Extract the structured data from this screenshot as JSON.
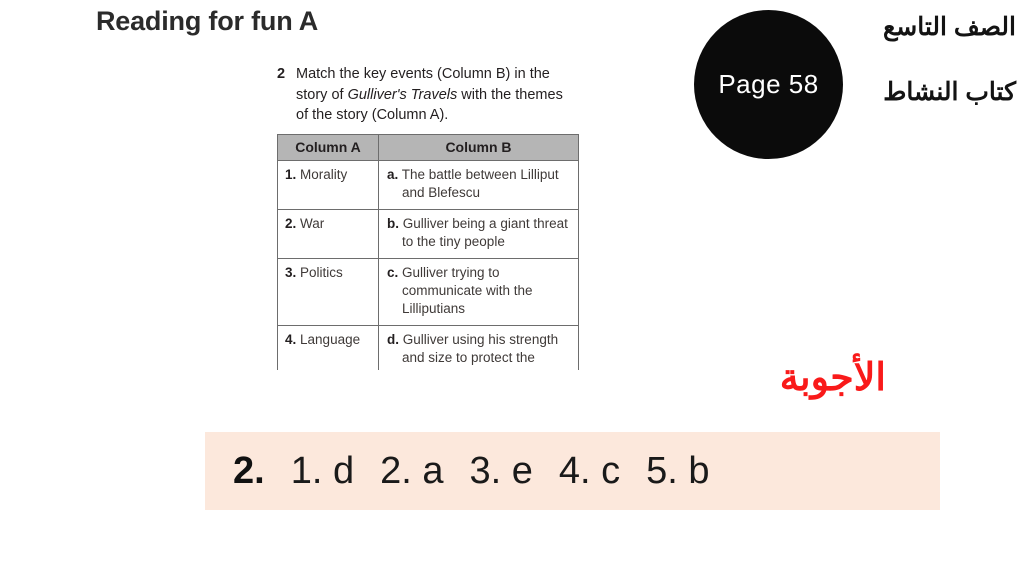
{
  "page_title": "Reading for fun A",
  "worksheet": {
    "instruction_number": "2",
    "instruction_part1": "Match the key events (Column B) in the story of ",
    "instruction_italic": "Gulliver's Travels",
    "instruction_part2": " with the themes of the story (Column A).",
    "table": {
      "headers": [
        "Column A",
        "Column B"
      ],
      "rows": [
        {
          "a_marker": "1.",
          "a_text": "Morality",
          "b_marker": "a.",
          "b_text": "The battle between Lilliput and Blefescu"
        },
        {
          "a_marker": "2.",
          "a_text": "War",
          "b_marker": "b.",
          "b_text": "Gulliver being a giant threat to the tiny people"
        },
        {
          "a_marker": "3.",
          "a_text": "Politics",
          "b_marker": "c.",
          "b_text": "Gulliver trying to communicate with the Lilliputians"
        },
        {
          "a_marker": "4.",
          "a_text": "Language",
          "b_marker": "d.",
          "b_text": "Gulliver using his strength and size to protect the people of"
        }
      ]
    }
  },
  "badge": {
    "page_label": "Page 58"
  },
  "meta": {
    "grade": "الصف التاسع",
    "book": "كتاب النشاط"
  },
  "answers_heading": "الأجوبة",
  "answer_strip": {
    "exercise_number": "2.",
    "items": [
      "1. d",
      "2. a",
      "3. e",
      "4. c",
      "5. b"
    ]
  },
  "colors": {
    "badge_background": "#0b0b0b",
    "answers_heading": "#f91a1a",
    "answer_strip_background": "#fce8dc",
    "table_header_background": "#b5b5b5",
    "table_border": "#6d6d6d"
  }
}
